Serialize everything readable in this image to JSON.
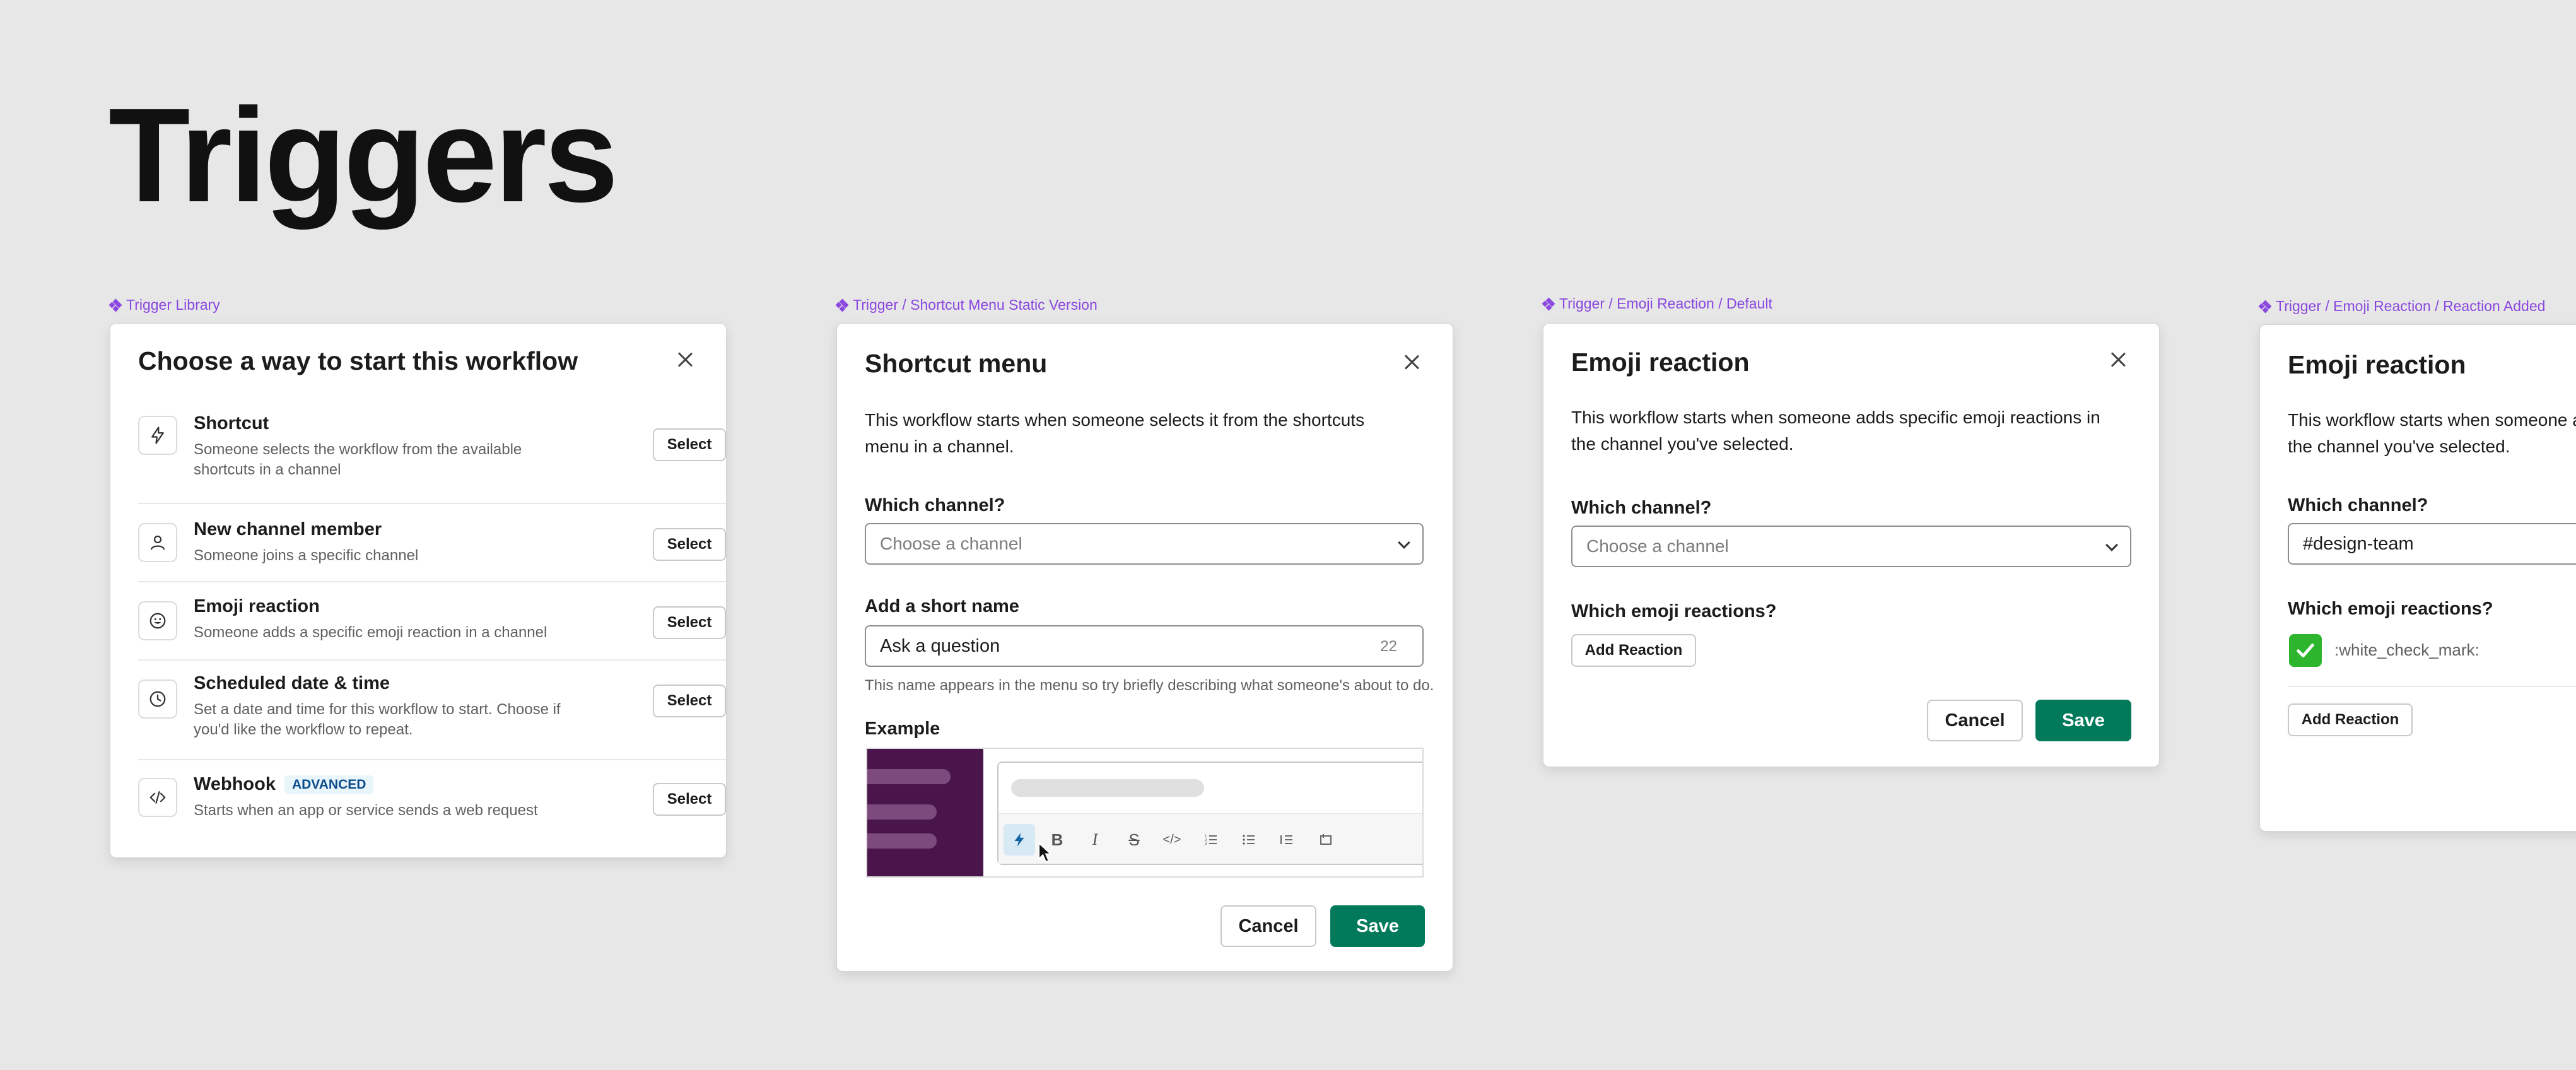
{
  "page": {
    "title": "Triggers"
  },
  "frames": {
    "library": "Trigger Library",
    "shortcut": "Trigger / Shortcut Menu Static Version",
    "emoji_default": "Trigger / Emoji Reaction / Default",
    "emoji_added": "Trigger / Emoji Reaction / Reaction Added"
  },
  "library": {
    "title": "Choose a way to start this workflow",
    "select_label": "Select",
    "items": [
      {
        "name": "Shortcut",
        "desc": "Someone selects the workflow from the available shortcuts in a channel",
        "icon": "lightning-icon"
      },
      {
        "name": "New channel member",
        "desc": "Someone joins a specific channel",
        "icon": "person-icon"
      },
      {
        "name": "Emoji reaction",
        "desc": "Someone adds a specific emoji reaction in a channel",
        "icon": "smiley-icon"
      },
      {
        "name": "Scheduled date & time",
        "desc": "Set a date and time for this workflow to start. Choose if you'd like the workflow to repeat.",
        "icon": "clock-icon"
      },
      {
        "name": "Webhook",
        "badge": "ADVANCED",
        "desc": "Starts when an app or service sends a web request",
        "icon": "code-icon"
      }
    ]
  },
  "shortcut": {
    "title": "Shortcut menu",
    "description": "This workflow starts when someone selects it from the shortcuts menu in a channel.",
    "channel_label": "Which channel?",
    "channel_placeholder": "Choose a channel",
    "name_label": "Add a short name",
    "name_value": "Ask a question",
    "char_count": "22",
    "hint": "This name appears in the menu so try briefly describing what someone's about to do.",
    "example_label": "Example",
    "cancel": "Cancel",
    "save": "Save"
  },
  "emoji_default": {
    "title": "Emoji reaction",
    "description": "This workflow starts when someone adds specific emoji reactions in the channel you've selected.",
    "channel_label": "Which channel?",
    "channel_placeholder": "Choose a channel",
    "reactions_label": "Which emoji reactions?",
    "add_reaction": "Add Reaction",
    "cancel": "Cancel",
    "save": "Save"
  },
  "emoji_added": {
    "title": "Emoji reaction",
    "description": "This workflow starts when someone adds specific emoji reactions in the channel you've selected.",
    "channel_label": "Which channel?",
    "channel_value": "#design-team",
    "reactions_label": "Which emoji reactions?",
    "reaction_code": ":white_check_mark:",
    "add_reaction": "Add Reaction"
  },
  "colors": {
    "accent": "#8a48e0",
    "save": "#007a5a",
    "aubergine": "#4a154b"
  }
}
